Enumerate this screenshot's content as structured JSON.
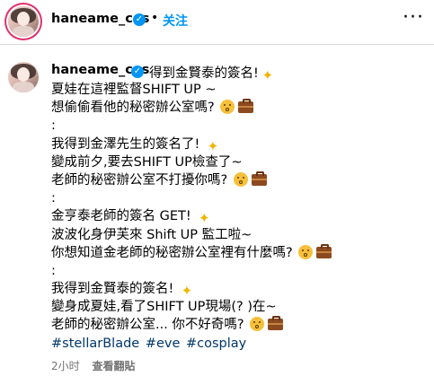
{
  "header": {
    "username": "haneame_cos",
    "verified_icon": "verified-badge-icon",
    "separator": "•",
    "follow_label": "关注",
    "more_icon": "more-options-icon"
  },
  "caption": {
    "username": "haneame_cos",
    "first_line": "得到金賢泰的簽名!",
    "lines": [
      "夏娃在這裡監督SHIFT UP ~",
      "想偷偷看他的秘密辦公室嗎?",
      ":",
      "我得到金澤先生的簽名了!",
      "變成前夕,要去SHIFT UP檢查了~",
      "老師的秘密辦公室不打擾你嗎?",
      ":",
      "金亨泰老師的簽名 GET!",
      "波波化身伊芙來 Shift UP 監工啦~",
      "你想知道金老師的秘密辦公室裡有什麼嗎?",
      ":",
      "我得到金賢泰的簽名!",
      "變身成夏娃,看了SHIFT UP現場(? )在~",
      "老師的秘密辦公室... 你不好奇嗎?"
    ],
    "hashtags": [
      "#stellarBlade",
      "#eve",
      "#cosplay"
    ]
  },
  "meta": {
    "time": "2小时",
    "translate_label": "查看翻貼"
  }
}
